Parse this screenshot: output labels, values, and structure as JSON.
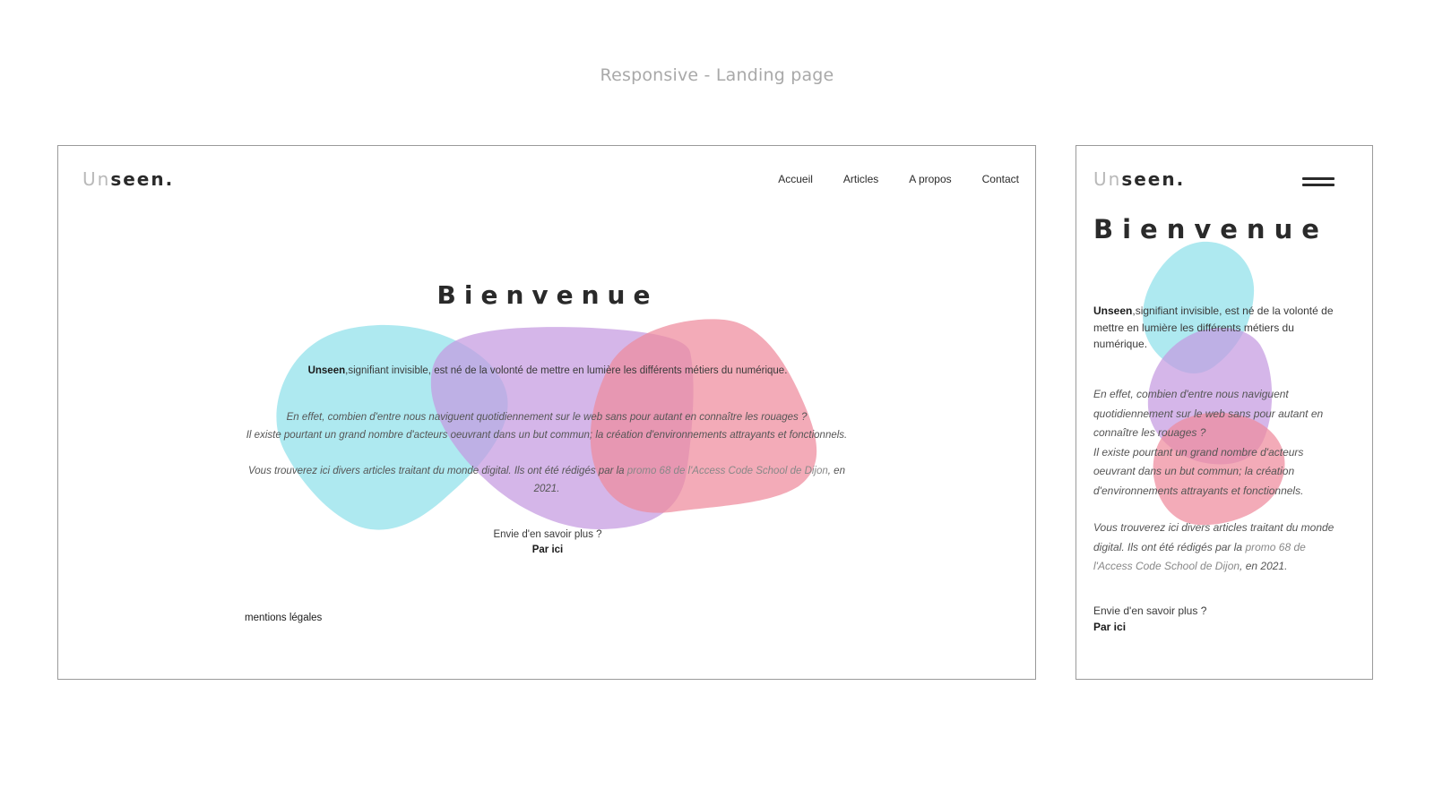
{
  "page": {
    "caption": "Responsive - Landing page"
  },
  "colors": {
    "blob_cyan": "#8fe1ea",
    "blob_purple": "#c59ae1",
    "blob_pink": "#ef8a9c",
    "frame_border": "#9a9a9a",
    "text_dark": "#2a2a2a",
    "logo_light": "#b9b9b9"
  },
  "desktop": {
    "logo": {
      "light": "Un",
      "bold": "seen."
    },
    "nav": [
      "Accueil",
      "Articles",
      "A propos",
      "Contact"
    ],
    "title": "Bienvenue",
    "intro": {
      "brand": "Unseen",
      "text": ",signifiant invisible, est né de la volonté de mettre en lumière les différents métiers du numérique."
    },
    "para1_line1": "En effet, combien d'entre nous naviguent quotidiennement sur le web sans pour autant en connaître les rouages ?",
    "para1_line2": "Il existe pourtant un grand nombre d'acteurs oeuvrant dans un but commun; la création d'environnements attrayants et fonctionnels.",
    "para2": {
      "before": "Vous trouverez ici divers articles traitant du monde digital. Ils ont été rédigés par la ",
      "link": "promo 68 de l'Access Code School de Dijon",
      "after": ", en 2021."
    },
    "cta_question": "Envie d'en savoir plus ?",
    "cta_link": "Par ici",
    "legal": "mentions légales"
  },
  "mobile": {
    "logo": {
      "light": "Un",
      "bold": "seen."
    },
    "menu_icon": "hamburger-icon",
    "title": "Bienvenue",
    "intro": {
      "brand": "Unseen",
      "text": ",signifiant invisible, est né de la volonté de mettre en lumière les différents métiers du numérique."
    },
    "para1_line1": "En effet, combien d'entre nous naviguent quotidiennement sur le web sans pour autant en connaître les rouages ?",
    "para1_line2": "Il existe pourtant un grand nombre d'acteurs oeuvrant dans un but commun; la création d'environnements attrayants et fonctionnels.",
    "para2": {
      "before": "Vous trouverez ici divers articles traitant du monde digital. Ils ont été rédigés par la ",
      "link": "promo 68 de l'Access Code School de Dijon",
      "after": ", en 2021."
    },
    "cta_question": "Envie d'en savoir plus ?",
    "cta_link": "Par ici"
  }
}
